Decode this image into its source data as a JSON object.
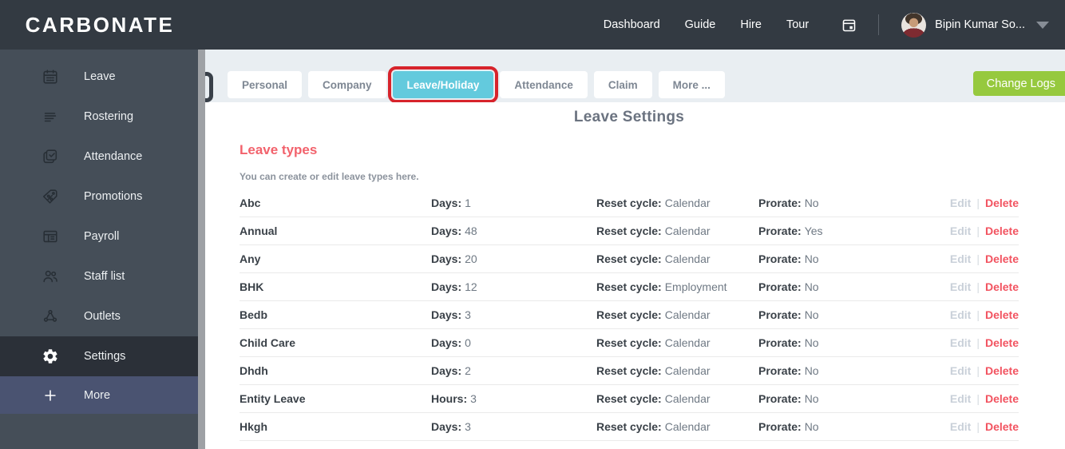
{
  "brand": {
    "name": "CARBONATE"
  },
  "topnav": {
    "links": [
      {
        "label": "Dashboard",
        "slug": "dashboard"
      },
      {
        "label": "Guide",
        "slug": "guide"
      },
      {
        "label": "Hire",
        "slug": "hire"
      },
      {
        "label": "Tour",
        "slug": "tour"
      }
    ],
    "user": {
      "name": "Bipin Kumar So..."
    }
  },
  "sidebar": {
    "items": [
      {
        "label": "Leave",
        "icon": "calendar",
        "slug": "leave"
      },
      {
        "label": "Rostering",
        "icon": "rostering",
        "slug": "rostering"
      },
      {
        "label": "Attendance",
        "icon": "attendance",
        "slug": "attendance"
      },
      {
        "label": "Promotions",
        "icon": "promotions",
        "slug": "promotions"
      },
      {
        "label": "Payroll",
        "icon": "payroll",
        "slug": "payroll"
      },
      {
        "label": "Staff list",
        "icon": "staff",
        "slug": "staff-list"
      },
      {
        "label": "Outlets",
        "icon": "outlets",
        "slug": "outlets"
      },
      {
        "label": "Settings",
        "icon": "settings",
        "slug": "settings",
        "active": true
      },
      {
        "label": "More",
        "icon": "plus",
        "slug": "more",
        "variant": "accent"
      }
    ]
  },
  "tabs": [
    {
      "label": "Personal",
      "slug": "personal"
    },
    {
      "label": "Company",
      "slug": "company"
    },
    {
      "label": "Leave/Holiday",
      "slug": "leave-holiday",
      "active": true,
      "highlighted": true
    },
    {
      "label": "Attendance",
      "slug": "attendance"
    },
    {
      "label": "Claim",
      "slug": "claim"
    },
    {
      "label": "More ...",
      "slug": "more"
    }
  ],
  "change_logs_label": "Change Logs",
  "main": {
    "title": "Leave Settings",
    "section": {
      "title": "Leave types",
      "help": "You can create or edit leave types here."
    },
    "actions": {
      "edit": "Edit",
      "divider": "|",
      "delete": "Delete"
    },
    "rows": [
      {
        "name": "Abc",
        "qty_label": "Days:",
        "qty_value": "1",
        "reset_label": "Reset cycle:",
        "reset_value": "Calendar",
        "prorate_label": "Prorate:",
        "prorate_value": "No"
      },
      {
        "name": "Annual",
        "qty_label": "Days:",
        "qty_value": "48",
        "reset_label": "Reset cycle:",
        "reset_value": "Calendar",
        "prorate_label": "Prorate:",
        "prorate_value": "Yes"
      },
      {
        "name": "Any",
        "qty_label": "Days:",
        "qty_value": "20",
        "reset_label": "Reset cycle:",
        "reset_value": "Calendar",
        "prorate_label": "Prorate:",
        "prorate_value": "No"
      },
      {
        "name": "BHK",
        "qty_label": "Days:",
        "qty_value": "12",
        "reset_label": "Reset cycle:",
        "reset_value": "Employment",
        "prorate_label": "Prorate:",
        "prorate_value": "No"
      },
      {
        "name": "Bedb",
        "qty_label": "Days:",
        "qty_value": "3",
        "reset_label": "Reset cycle:",
        "reset_value": "Calendar",
        "prorate_label": "Prorate:",
        "prorate_value": "No"
      },
      {
        "name": "Child Care",
        "qty_label": "Days:",
        "qty_value": "0",
        "reset_label": "Reset cycle:",
        "reset_value": "Calendar",
        "prorate_label": "Prorate:",
        "prorate_value": "No"
      },
      {
        "name": "Dhdh",
        "qty_label": "Days:",
        "qty_value": "2",
        "reset_label": "Reset cycle:",
        "reset_value": "Calendar",
        "prorate_label": "Prorate:",
        "prorate_value": "No"
      },
      {
        "name": "Entity Leave",
        "qty_label": "Hours:",
        "qty_value": "3",
        "reset_label": "Reset cycle:",
        "reset_value": "Calendar",
        "prorate_label": "Prorate:",
        "prorate_value": "No"
      },
      {
        "name": "Hkgh",
        "qty_label": "Days:",
        "qty_value": "3",
        "reset_label": "Reset cycle:",
        "reset_value": "Calendar",
        "prorate_label": "Prorate:",
        "prorate_value": "No"
      }
    ]
  },
  "colors": {
    "topbar": "#333A42",
    "sidebar": "#454E58",
    "sidebar_active": "#2B3038",
    "sidebar_accent": "#4A5371",
    "tab_active_cyan": "#63CADD",
    "highlight_red": "#D7232B",
    "button_green": "#96C93E",
    "title_gray": "#6B7380",
    "section_red": "#F2626C",
    "delete_red": "#F25360"
  }
}
